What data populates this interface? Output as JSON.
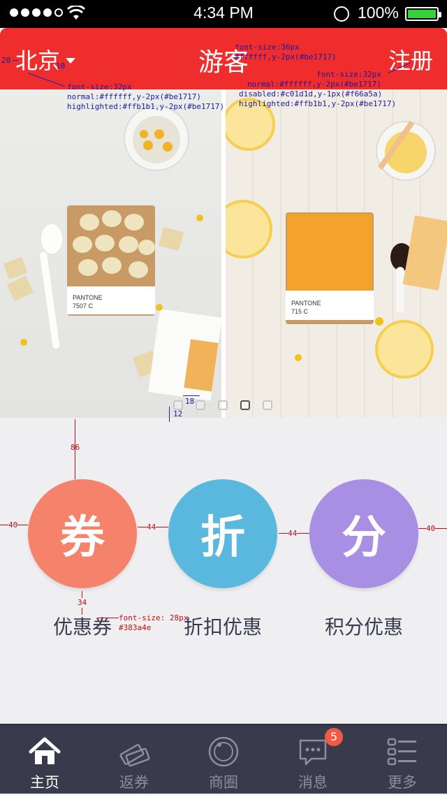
{
  "status_bar": {
    "time": "4:34 PM",
    "battery_percent": "100%",
    "signal_bars_filled": 4,
    "signal_bars_total": 5
  },
  "header": {
    "city": "北京",
    "title": "游客",
    "register": "注册",
    "background_color": "#ef2d2d"
  },
  "banner": {
    "page_count": 5,
    "active_page": 4,
    "left_card_text": "PANTONE\n7507 C",
    "right_card_text": "PANTONE\n715 C"
  },
  "features": [
    {
      "glyph": "券",
      "label": "优惠券",
      "color": "#f5826b"
    },
    {
      "glyph": "折",
      "label": "折扣优惠",
      "color": "#5ab8df"
    },
    {
      "glyph": "分",
      "label": "积分优惠",
      "color": "#a98fe3"
    }
  ],
  "annotations": {
    "city_spacing_left": "20",
    "city_spacing_arrow": "10",
    "title_spec": "font-size:36px\n#ffffff,y-2px(#be1717)",
    "city_spec": "font-size:32px\nnormal:#ffffff,y-2px(#be1717)\nhighlighted:#ffb1b1,y-2px(#be1717)",
    "register_spec": "font-size:32px\nnormal:#ffffff,y-2px(#be1717)\ndisabled:#c01d1d,y-1px(#f66a5a)\nhighlighted:#ffb1b1,y-2px(#be1717)",
    "dot_gap": "18",
    "dot_bottom": "12",
    "cards_top": "86",
    "cards_left": "40",
    "cards_gap_1": "44",
    "cards_gap_2": "44",
    "cards_right": "40",
    "label_gap": "34",
    "label_spec": "font-size: 28px\n#383a4e"
  },
  "tabbar": {
    "items": [
      {
        "label": "主页",
        "icon": "home-icon",
        "active": true
      },
      {
        "label": "返券",
        "icon": "tickets-icon",
        "active": false
      },
      {
        "label": "商圈",
        "icon": "circle-orbit-icon",
        "active": false
      },
      {
        "label": "消息",
        "icon": "message-bubble-icon",
        "active": false
      },
      {
        "label": "更多",
        "icon": "list-menu-icon",
        "active": false
      }
    ],
    "message_badge": "5"
  }
}
